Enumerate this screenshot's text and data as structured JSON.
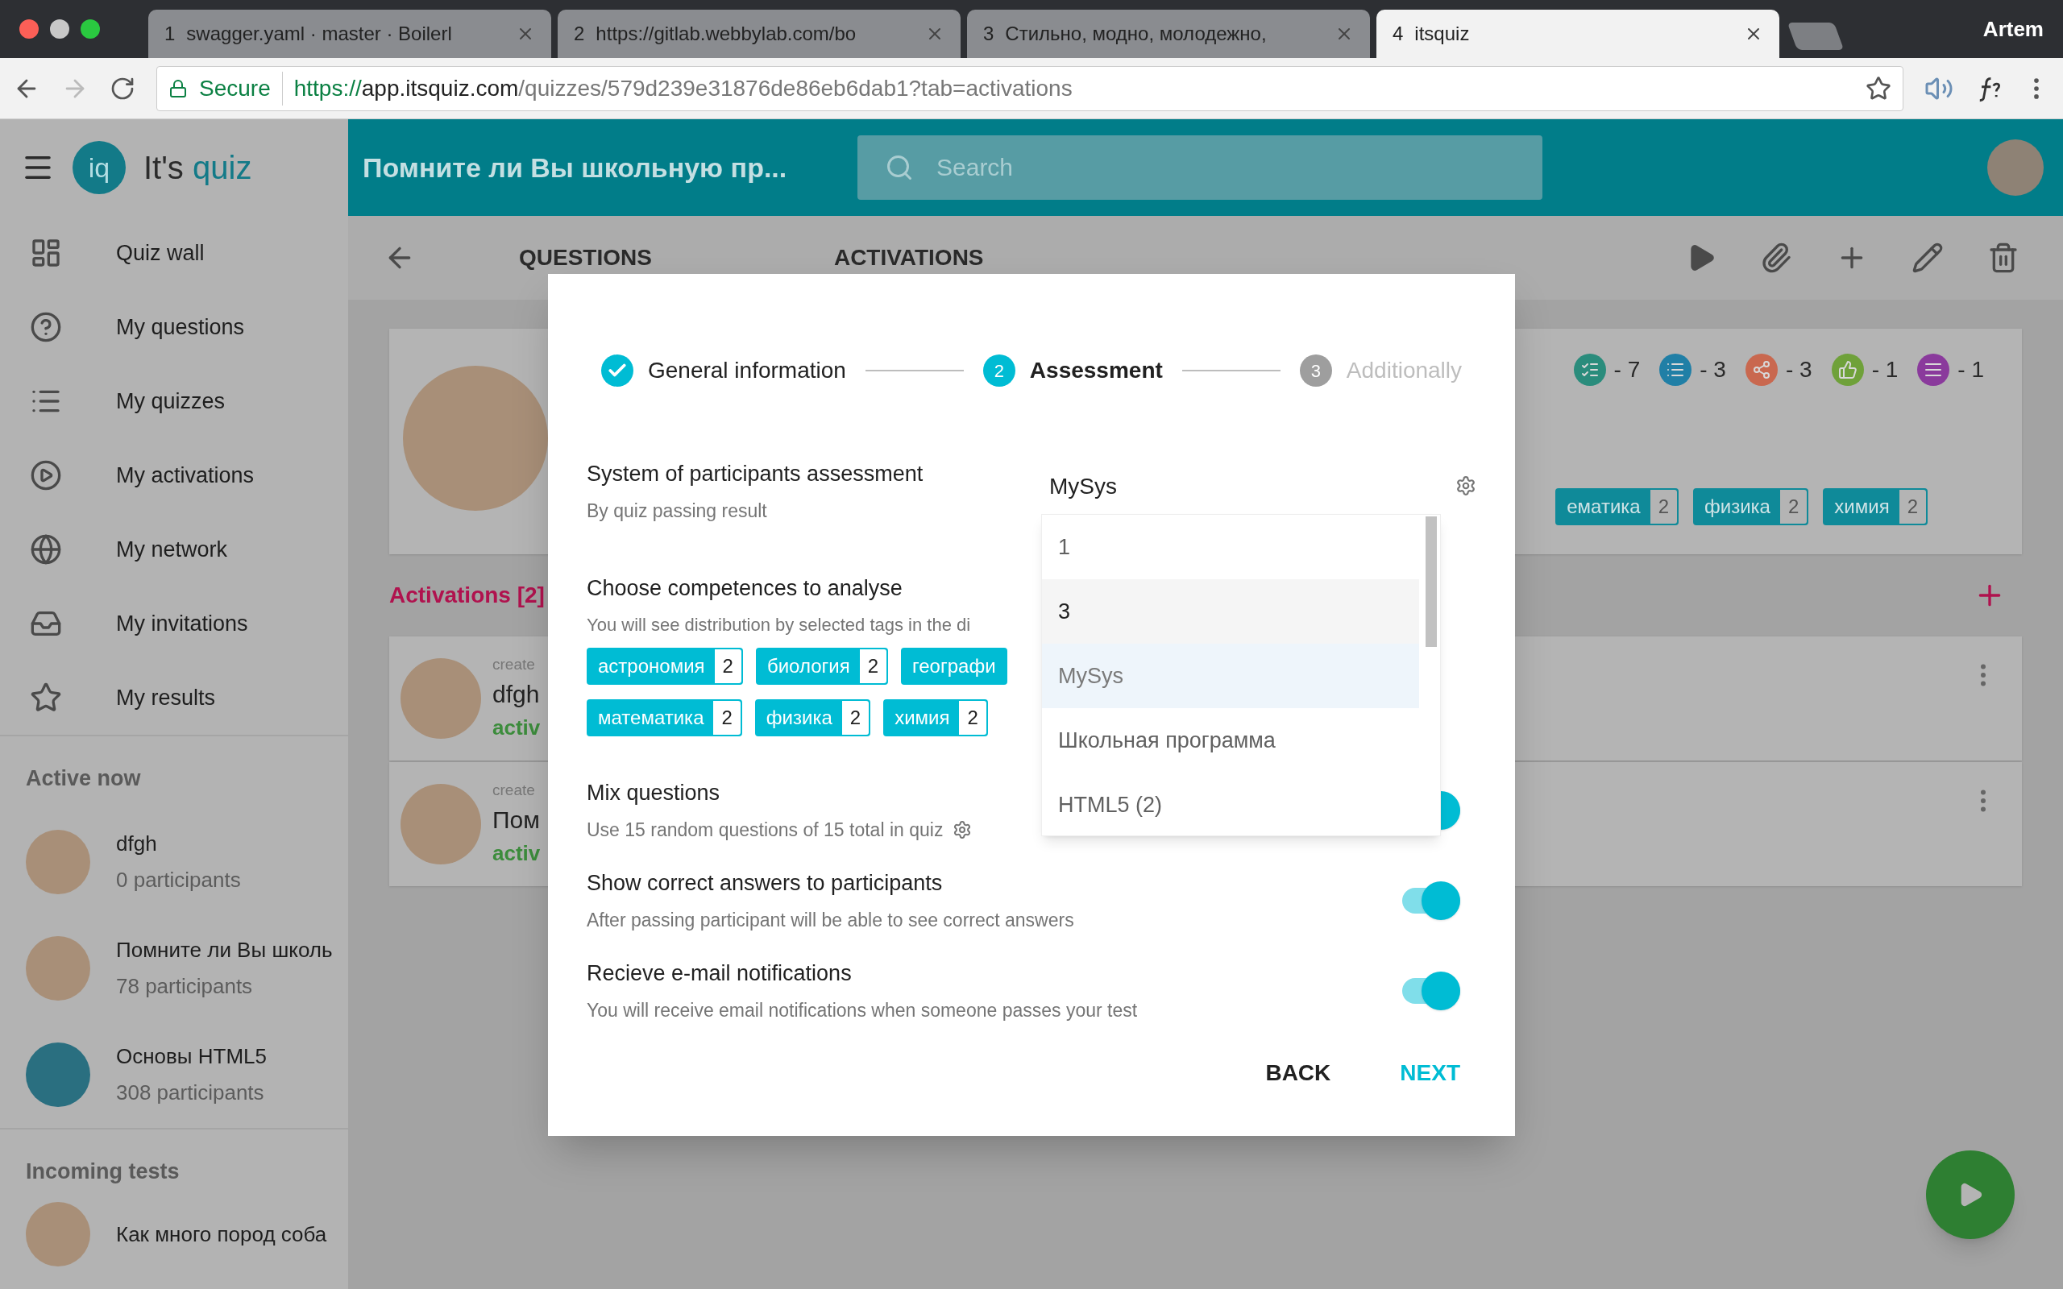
{
  "browser": {
    "tabs": [
      {
        "number": "1",
        "title": "swagger.yaml · master · Boilerl",
        "selected": false
      },
      {
        "number": "2",
        "title": "https://gitlab.webbylab.com/bo",
        "selected": false
      },
      {
        "number": "3",
        "title": "Стильно, модно, молодежно,",
        "selected": false
      },
      {
        "number": "4",
        "title": "itsquiz",
        "selected": true
      }
    ],
    "profile": "Artem",
    "secure_label": "Secure",
    "url": {
      "scheme": "https://",
      "host": "app.itsquiz.com",
      "path": "/quizzes/579d239e31876de86eb6dab1?tab=activations"
    }
  },
  "sidebar": {
    "logo": {
      "mark": "iq",
      "name": "It's",
      "accent": "quiz"
    },
    "items": [
      {
        "label": "Quiz wall"
      },
      {
        "label": "My questions"
      },
      {
        "label": "My quizzes"
      },
      {
        "label": "My activations"
      },
      {
        "label": "My network"
      },
      {
        "label": "My invitations"
      },
      {
        "label": "My results"
      }
    ],
    "sections": [
      {
        "title": "Active now",
        "items": [
          {
            "title": "dfgh",
            "subtitle": "0 participants",
            "kind": "photo"
          },
          {
            "title": "Помните ли Вы школь",
            "subtitle": "78 participants",
            "kind": "photo"
          },
          {
            "title": "Основы HTML5",
            "subtitle": "308 participants",
            "kind": "logo"
          }
        ]
      },
      {
        "title": "Incoming tests",
        "items": [
          {
            "title": "Как много пород соба",
            "kind": "photo"
          }
        ]
      }
    ]
  },
  "header": {
    "title": "Помните ли Вы школьную пр...",
    "search_placeholder": "Search"
  },
  "toolbar": {
    "tabs": [
      {
        "label": "QUESTIONS"
      },
      {
        "label": "ACTIVATIONS"
      }
    ]
  },
  "quiz_card": {
    "stats": [
      {
        "kind": "checklist",
        "color": "#2a8c7c",
        "count": "- 7"
      },
      {
        "kind": "list",
        "color": "#207fa6",
        "count": "- 3"
      },
      {
        "kind": "share",
        "color": "#c9684f",
        "count": "- 3"
      },
      {
        "kind": "thumbs",
        "color": "#6fa13a",
        "count": "- 1"
      },
      {
        "kind": "lines",
        "color": "#8a3a9c",
        "count": "- 1"
      }
    ],
    "tags": [
      {
        "label": "ематика",
        "count": "2"
      },
      {
        "label": "физика",
        "count": "2"
      },
      {
        "label": "химия",
        "count": "2"
      }
    ]
  },
  "activations": {
    "title": "Activations [2]",
    "items": [
      {
        "created": "create",
        "title": "dfgh",
        "status": "activ"
      },
      {
        "created": "create",
        "title": "Пом",
        "status": "activ"
      }
    ]
  },
  "dialog": {
    "steps": [
      {
        "label": "General information",
        "completed": true,
        "selected": false
      },
      {
        "number": "2",
        "label": "Assessment",
        "completed": false,
        "selected": true
      },
      {
        "number": "3",
        "label": "Additionally",
        "completed": false,
        "selected": false
      }
    ],
    "assessment": {
      "title": "System of participants assessment",
      "subtitle": "By quiz passing result",
      "value": "MySys",
      "options": [
        {
          "label": "1",
          "hovered": false,
          "selected": false
        },
        {
          "label": "3",
          "hovered": true,
          "selected": false
        },
        {
          "label": "MySys",
          "hovered": false,
          "selected": true
        },
        {
          "label": "Школьная программа",
          "hovered": false,
          "selected": false
        },
        {
          "label": "HTML5 (2)",
          "hovered": false,
          "selected": false
        }
      ]
    },
    "competences": {
      "title": "Choose competences to analyse",
      "subtitle": "You will see distribution by selected tags in the di",
      "tag_rows": [
        [
          {
            "label": "астрономия",
            "count": "2"
          },
          {
            "label": "биология",
            "count": "2"
          },
          {
            "label": "географи"
          }
        ],
        [
          {
            "label": "математика",
            "count": "2"
          },
          {
            "label": "физика",
            "count": "2"
          },
          {
            "label": "химия",
            "count": "2"
          }
        ]
      ]
    },
    "settings": [
      {
        "title": "Mix questions",
        "subtitle": "Use 15 random questions of 15 total in quiz",
        "gear": true,
        "on": true
      },
      {
        "title": "Show correct answers to participants",
        "subtitle": "After passing participant will be able to see correct answers",
        "gear": false,
        "on": true
      },
      {
        "title": "Recieve e-mail notifications",
        "subtitle": "You will receive email notifications when someone passes your test",
        "gear": false,
        "on": true
      }
    ],
    "buttons": [
      {
        "label": "BACK",
        "kind": "plain"
      },
      {
        "label": "NEXT",
        "kind": "primary"
      }
    ]
  }
}
